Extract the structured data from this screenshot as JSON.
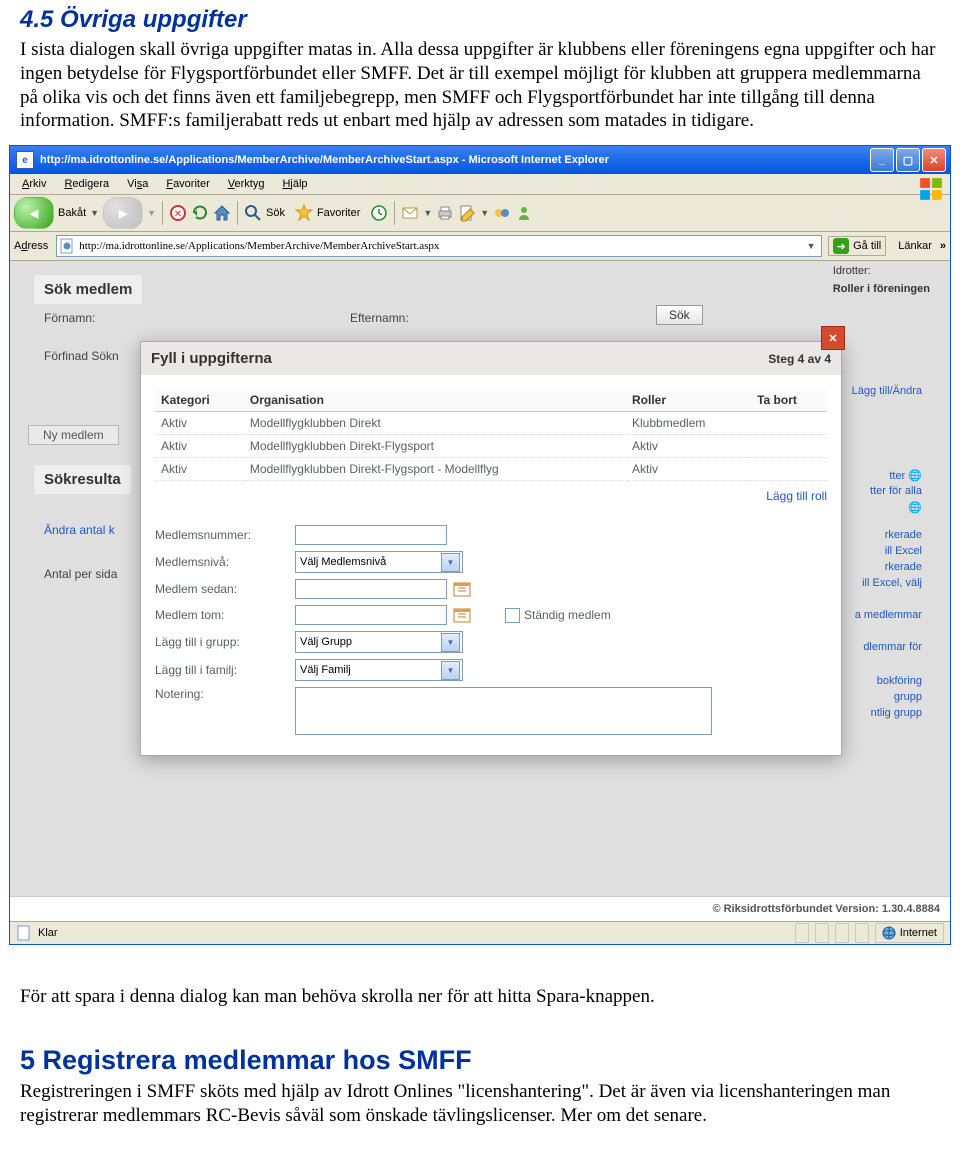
{
  "sect45": {
    "heading": "4.5  Övriga uppgifter",
    "p1": "I sista dialogen skall övriga uppgifter matas in. Alla dessa uppgifter är klubbens eller föreningens egna uppgifter och har ingen betydelse för Flygsportförbundet eller SMFF. Det är till exempel möjligt för klubben att gruppera medlemmarna på olika vis och det finns även ett familjebegrepp, men SMFF och Flygsportförbundet har inte tillgång till denna information. SMFF:s familjerabatt reds ut enbart med hjälp av adressen som matades in tidigare."
  },
  "sect_after": {
    "p": "För att spara i denna dialog kan man behöva skrolla ner för att hitta Spara-knappen."
  },
  "sect5": {
    "heading": "5   Registrera medlemmar hos SMFF",
    "p": "Registreringen i SMFF sköts med hjälp av Idrott Onlines \"licenshantering\". Det är även via licenshanteringen man registrerar medlemmars RC-Bevis såväl som önskade tävlingslicenser. Mer om det senare."
  },
  "ie": {
    "title": "http://ma.idrottonline.se/Applications/MemberArchive/MemberArchiveStart.aspx - Microsoft Internet Explorer",
    "menu": [
      "Arkiv",
      "Redigera",
      "Visa",
      "Favoriter",
      "Verktyg",
      "Hjälp"
    ],
    "toolbar": {
      "back": "Bakåt",
      "search": "Sök",
      "fav": "Favoriter"
    },
    "addrLabel": "Adress",
    "addr": "http://ma.idrottonline.se/Applications/MemberArchive/MemberArchiveStart.aspx",
    "go": "Gå till",
    "links": "Länkar",
    "status_left": "Klar",
    "status_right": "Internet"
  },
  "bg": {
    "sokMedlem": "Sök medlem",
    "fornamn": "Förnamn:",
    "efternamn": "Efternamn:",
    "sok": "Sök",
    "forfinad": "Förfinad Sökn",
    "nyMedlem": "Ny medlem",
    "sokresultat": "Sökresulta",
    "andraAntal": "Ändra antal k",
    "antalPerSida": "Antal per sida",
    "idrotter": "Idrotter:",
    "roller": "Roller i föreningen",
    "laggTillAndra": "Lägg till/Ändra",
    "frag1": "tter",
    "frag2": "tter för alla",
    "frag3": "rkerade",
    "frag4": "ill Excel",
    "frag5": "rkerade",
    "frag6": "ill Excel, välj",
    "frag7": "a medlemmar",
    "frag8": "dlemmar för",
    "frag9": "bokföring",
    "frag10": "grupp",
    "frag11": "ntlig grupp"
  },
  "modal": {
    "title": "Fyll i uppgifterna",
    "step": "Steg 4 av 4",
    "headers": [
      "Kategori",
      "Organisation",
      "Roller",
      "Ta bort"
    ],
    "rows": [
      {
        "kat": "Aktiv",
        "org": "Modellflygklubben Direkt",
        "roll": "Klubbmedlem"
      },
      {
        "kat": "Aktiv",
        "org": "Modellflygklubben Direkt-Flygsport",
        "roll": "Aktiv"
      },
      {
        "kat": "Aktiv",
        "org": "Modellflygklubben Direkt-Flygsport - Modellflyg",
        "roll": "Aktiv"
      }
    ],
    "laggTillRoll": "Lägg till roll",
    "labels": {
      "medlemsnummer": "Medlemsnummer:",
      "medlemsniva": "Medlemsnivå:",
      "medlemSedan": "Medlem sedan:",
      "medlemTom": "Medlem tom:",
      "standigMedlem": "Ständig medlem",
      "laggTillGrupp": "Lägg till i grupp:",
      "laggTillFamilj": "Lägg till i familj:",
      "notering": "Notering:"
    },
    "selects": {
      "niva": "Välj Medlemsnivå",
      "grupp": "Välj Grupp",
      "familj": "Välj Familj"
    }
  },
  "pageFoot": "© Riksidrottsförbundet  Version: 1.30.4.8884"
}
